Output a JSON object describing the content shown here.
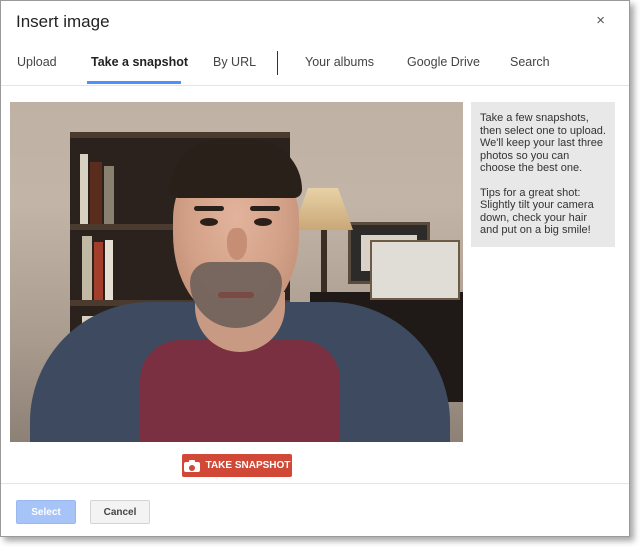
{
  "dialog": {
    "title": "Insert image",
    "close_glyph": "×"
  },
  "tabs": [
    {
      "label": "Upload"
    },
    {
      "label": "Take a snapshot",
      "active": true
    },
    {
      "label": "By URL"
    },
    {
      "label": "Your albums"
    },
    {
      "label": "Google Drive"
    },
    {
      "label": "Search"
    }
  ],
  "camera": {
    "snapshot_label": "TAKE SNAPSHOT",
    "snapshot_icon": "camera-icon"
  },
  "tip": {
    "paragraph1": "Take a few snapshots, then select one to upload. We'll keep your last three photos so you can choose the best one.",
    "paragraph2": "Tips for a great shot: Slightly tilt your camera down, check your hair and put on a big smile!"
  },
  "footer": {
    "select_label": "Select",
    "cancel_label": "Cancel"
  },
  "colors": {
    "accent_tab_underline": "#4d90fe",
    "snapshot_button": "#d14836",
    "select_button_disabled": "#a6c4f7"
  }
}
